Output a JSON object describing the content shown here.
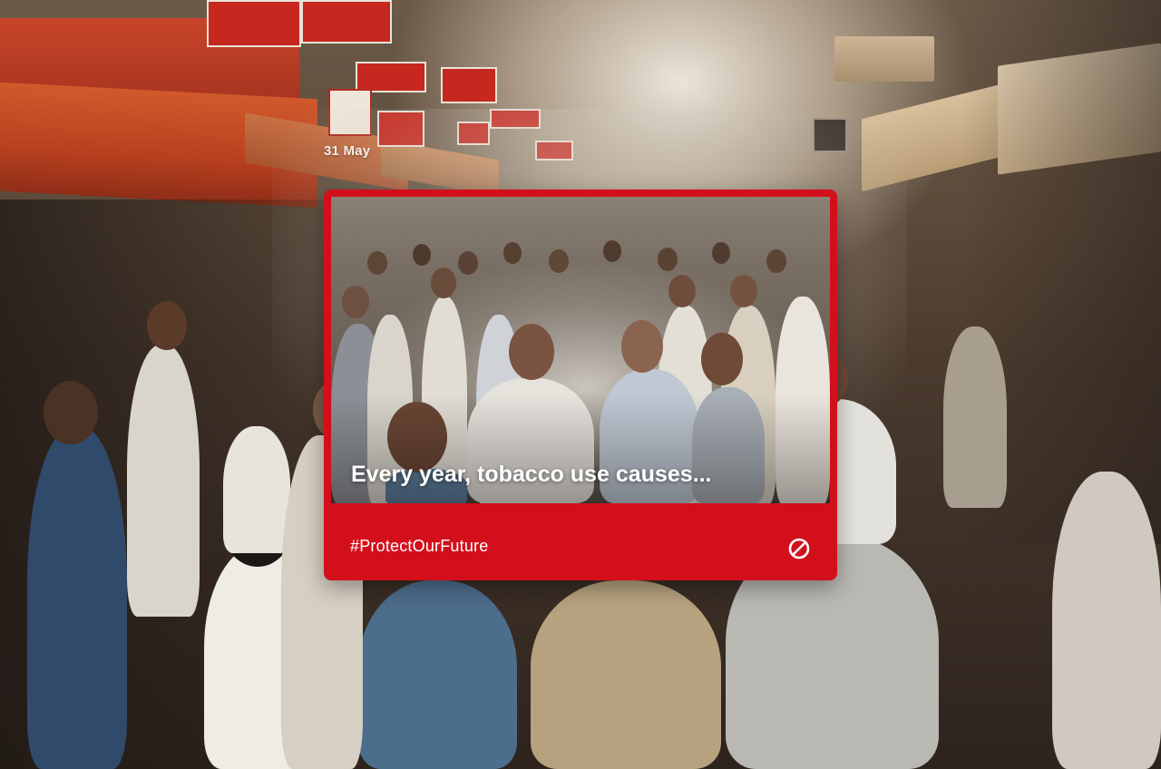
{
  "post": {
    "date": "31 May",
    "caption": "Every year, tobacco use causes...",
    "hashtag": "#ProtectOurFuture",
    "action_icon": "prohibited-icon"
  },
  "colors": {
    "card_red": "#d30f1c",
    "text_white": "#ffffff"
  }
}
